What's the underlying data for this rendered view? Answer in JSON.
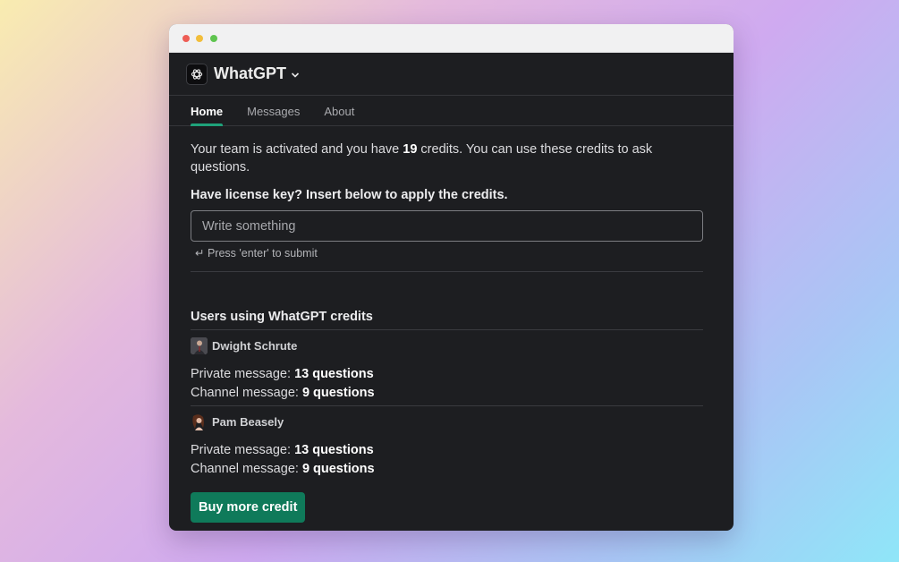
{
  "app": {
    "name": "WhatGPT"
  },
  "tabs": [
    {
      "label": "Home",
      "active": true
    },
    {
      "label": "Messages",
      "active": false
    },
    {
      "label": "About",
      "active": false
    }
  ],
  "home": {
    "intro_prefix": "Your team is activated and you have ",
    "credits": "19",
    "intro_suffix": " credits. You can use these credits to ask questions.",
    "license_label": "Have license key? Insert below to apply the credits.",
    "input_placeholder": "Write something",
    "hint": "↵ Press 'enter' to submit"
  },
  "users": {
    "title": "Users using WhatGPT credits",
    "private_label": "Private message: ",
    "channel_label": "Channel message: ",
    "list": [
      {
        "name": "Dwight Schrute",
        "private": "13 questions",
        "channel": "9 questions"
      },
      {
        "name": "Pam Beasely",
        "private": "13 questions",
        "channel": "9 questions"
      }
    ]
  },
  "buy_label": "Buy more credit",
  "colors": {
    "accent": "#1fa27a",
    "button": "#0f7a5a",
    "background": "#1d1e21"
  }
}
